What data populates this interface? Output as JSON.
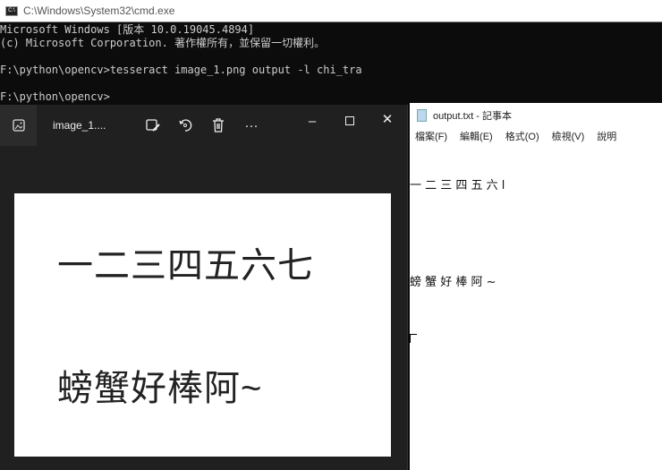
{
  "cmd": {
    "title": "C:\\Windows\\System32\\cmd.exe",
    "icon_text": "C:\\",
    "lines": [
      "Microsoft Windows [版本 10.0.19045.4894]",
      "(c) Microsoft Corporation. 著作權所有，並保留一切權利。",
      "",
      "F:\\python\\opencv>tesseract image_1.png output -l chi_tra",
      "",
      "F:\\python\\opencv>"
    ]
  },
  "photos": {
    "filename": "image_1....",
    "image_text": [
      "一二三四五六七",
      "螃蟹好棒阿~"
    ]
  },
  "notepad": {
    "title": "output.txt - 記事本",
    "menu": [
      "檔案(F)",
      "編輯(E)",
      "格式(O)",
      "檢視(V)",
      "說明"
    ],
    "lines": [
      "一 二 三 四 五 六 l",
      "",
      "螃 蟹 好 棒 阿 ~"
    ]
  }
}
